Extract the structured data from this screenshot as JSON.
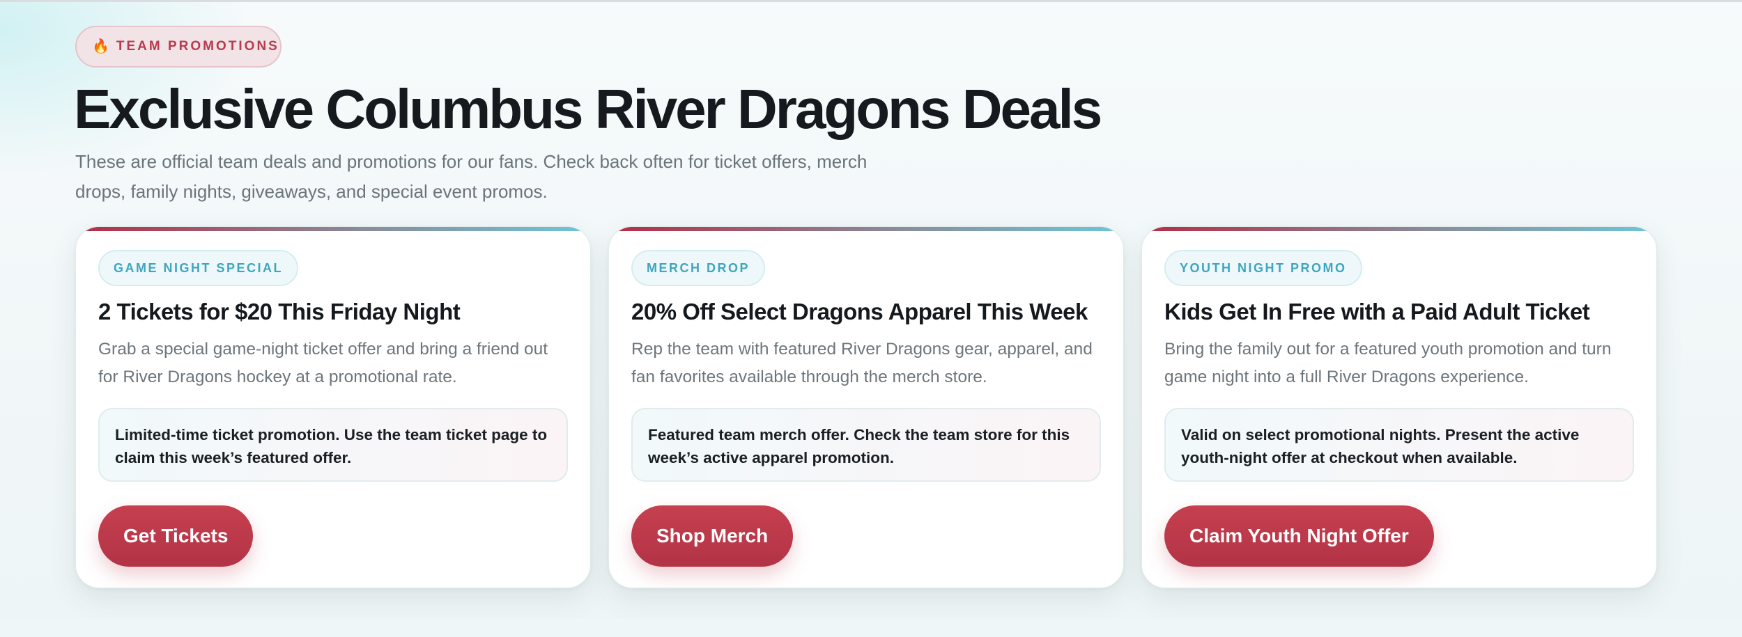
{
  "badge": {
    "icon": "fire-icon",
    "glyph": "🔥",
    "label": "TEAM PROMOTIONS"
  },
  "title": "Exclusive Columbus River Dragons Deals",
  "intro": "These are official team deals and promotions for our fans. Check back often for ticket offers, merch drops, family nights, giveaways, and special event promos.",
  "colors": {
    "accent": "#b93a4d",
    "button": "#c03d4e",
    "tag_text": "#3fa6bf",
    "heading": "#161a1e"
  },
  "cards": [
    {
      "tag": "GAME NIGHT SPECIAL",
      "title": "2 Tickets for $20 This Friday Night",
      "description": "Grab a special game-night ticket offer and bring a friend out for River Dragons hockey at a promotional rate.",
      "note": "Limited-time ticket promotion. Use the team ticket page to claim this week’s featured offer.",
      "button": "Get Tickets"
    },
    {
      "tag": "MERCH DROP",
      "title": "20% Off Select Dragons Apparel This Week",
      "description": "Rep the team with featured River Dragons gear, apparel, and fan favorites available through the merch store.",
      "note": "Featured team merch offer. Check the team store for this week’s active apparel promotion.",
      "button": "Shop Merch"
    },
    {
      "tag": "YOUTH NIGHT PROMO",
      "title": "Kids Get In Free with a Paid Adult Ticket",
      "description": "Bring the family out for a featured youth promotion and turn game night into a full River Dragons experience.",
      "note": "Valid on select promotional nights. Present the active youth-night offer at checkout when available.",
      "button": "Claim Youth Night Offer"
    }
  ]
}
